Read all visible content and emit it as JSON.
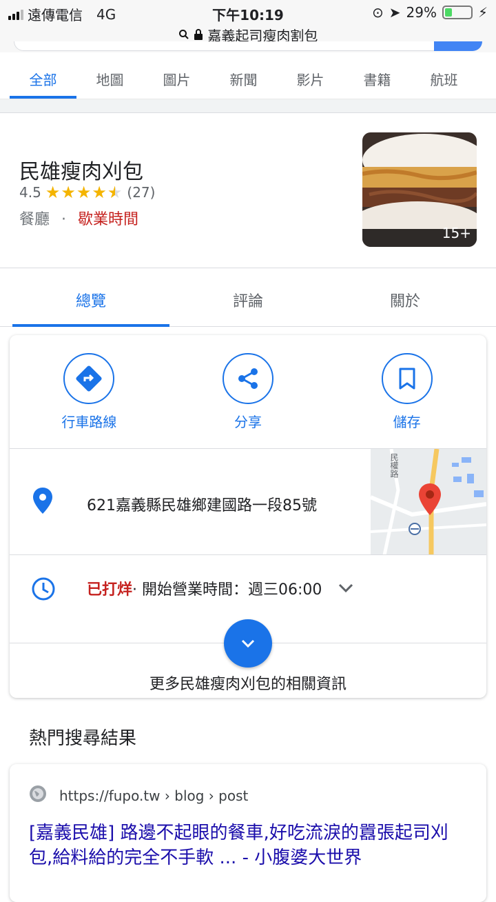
{
  "status_bar": {
    "carrier": "遠傳電信",
    "network": "4G",
    "time": "下午10:19",
    "battery_percent": "29%",
    "battery_level": 0.29
  },
  "url_bar": {
    "query": "嘉義起司瘦肉割包"
  },
  "nav_tabs": [
    "全部",
    "地圖",
    "圖片",
    "新聞",
    "影片",
    "書籍",
    "航班"
  ],
  "business": {
    "name": "民雄瘦肉刈包",
    "rating": "4.5",
    "stars": 4.5,
    "reviews": "(27)",
    "category": "餐廳",
    "separator": "·",
    "hours_link": "歇業時間",
    "photo_count": "15+"
  },
  "sub_tabs": [
    "總覽",
    "評論",
    "關於"
  ],
  "actions": [
    {
      "label": "行車路線",
      "icon": "directions-icon"
    },
    {
      "label": "分享",
      "icon": "share-icon"
    },
    {
      "label": "儲存",
      "icon": "bookmark-icon"
    }
  ],
  "address": "621嘉義縣民雄鄉建國路一段85號",
  "map": {
    "road_label": "民權路"
  },
  "hours": {
    "status": "已打烊",
    "detail": " · 開始營業時間：週三06:00"
  },
  "more_info": "更多民雄瘦肉刈包的相關資訊",
  "popular": {
    "title": "熱門搜尋結果",
    "result": {
      "url": "https://fupo.tw › blog › post",
      "title": "[嘉義民雄] 路邊不起眼的餐車,好吃流淚的囂張起司刈包,給料給的完全不手軟 ... - 小腹婆大世界"
    }
  },
  "colors": {
    "accent": "#1a73e8",
    "closed": "#c5221f",
    "star": "#f4b400",
    "link": "#1a0dab"
  }
}
